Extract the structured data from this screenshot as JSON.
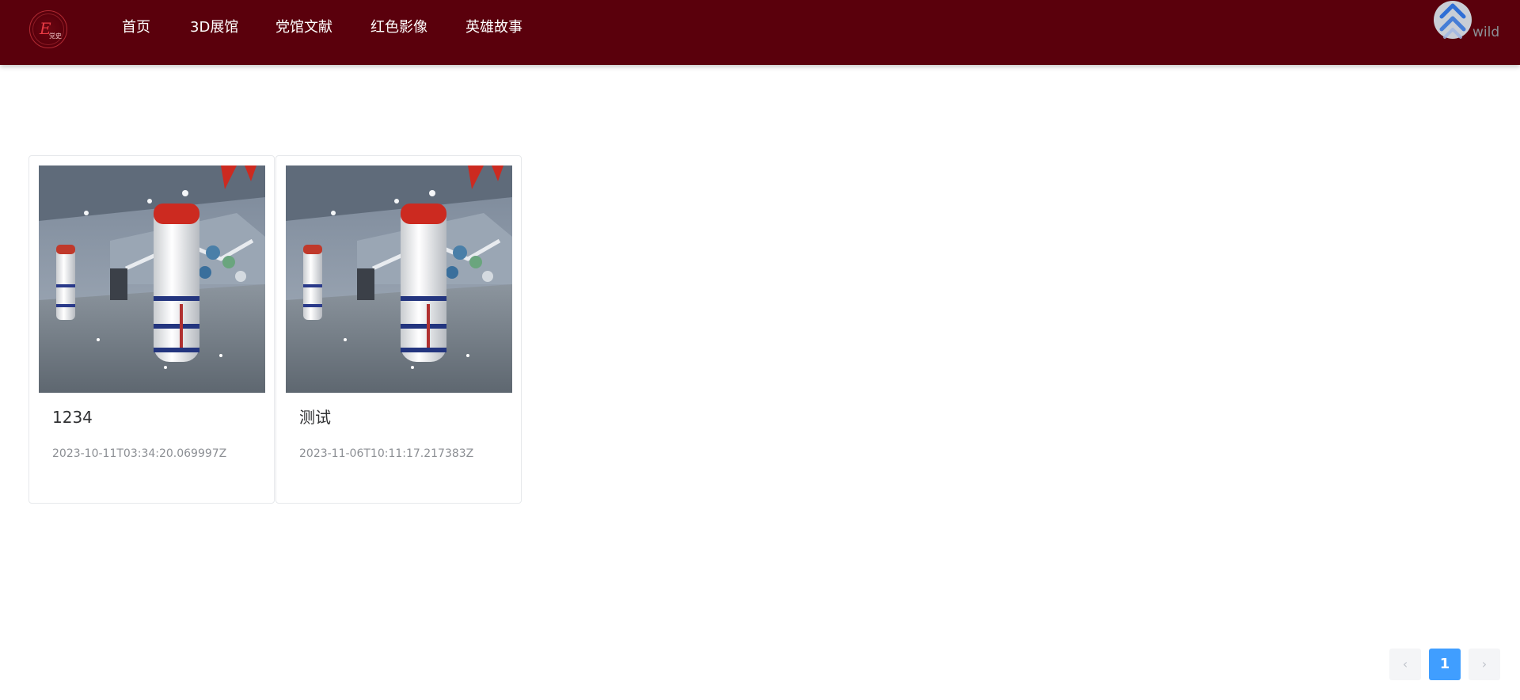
{
  "header": {
    "logo": {
      "letter": "E",
      "subtitle": "党史"
    },
    "nav": [
      {
        "label": "首页"
      },
      {
        "label": "3D展馆"
      },
      {
        "label": "党馆文献"
      },
      {
        "label": "红色影像"
      },
      {
        "label": "英雄故事"
      }
    ],
    "user": {
      "name": "wild",
      "avatar_icon": "double-chevron-up-icon"
    }
  },
  "cards": [
    {
      "title": "1234",
      "date": "2023-10-11T03:34:20.069997Z",
      "image": "exhibition-hall-rocket-photo"
    },
    {
      "title": "测试",
      "date": "2023-11-06T10:11:17.217383Z",
      "image": "exhibition-hall-rocket-photo"
    }
  ],
  "pagination": {
    "prev_icon": "chevron-left-icon",
    "current_page": "1",
    "next_icon": "chevron-right-icon",
    "prev_glyph": "‹",
    "next_glyph": "›"
  },
  "colors": {
    "header_bg": "#5a000c",
    "accent": "#409eff",
    "avatar_chevron": "#2f6fd6"
  }
}
